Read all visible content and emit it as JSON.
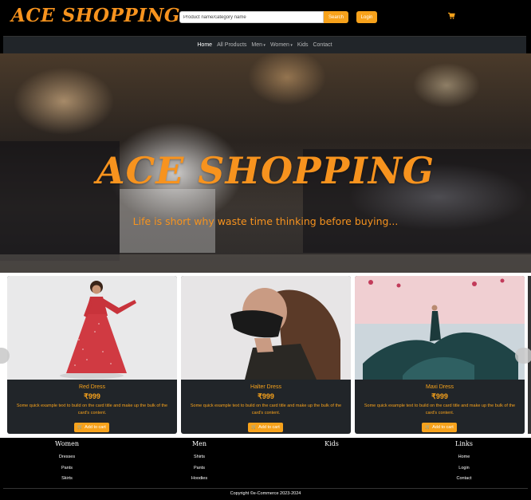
{
  "header": {
    "logo": "ACE SHOPPING",
    "search": {
      "placeholder": "Product name/category name",
      "value": ""
    },
    "search_label": "Search",
    "login_label": "Login",
    "cart_icon": "cart-icon"
  },
  "nav": {
    "items": [
      {
        "label": "Home"
      },
      {
        "label": "All Products"
      },
      {
        "label": "Men"
      },
      {
        "label": "Women"
      },
      {
        "label": "Kids"
      },
      {
        "label": "Contact"
      }
    ]
  },
  "hero": {
    "title": "ACE SHOPPING",
    "subtitle": "Life is short why waste time thinking before buying..."
  },
  "products": [
    {
      "name": "Red Dress",
      "price": "₹999",
      "text": "Some quick example text to build on the card title and make up the bulk of the card's content.",
      "cta": "Add to cart"
    },
    {
      "name": "Halter Dress",
      "price": "₹999",
      "text": "Some quick example text to build on the card title and make up the bulk of the card's content.",
      "cta": "Add to cart"
    },
    {
      "name": "Maxi Dress",
      "price": "₹999",
      "text": "Some quick example text to build on the card title and make up the bulk of the card's content.",
      "cta": "Add to cart"
    }
  ],
  "footer": {
    "columns": [
      {
        "heading": "Women",
        "links": [
          "Dresses",
          "Pants",
          "Skirts"
        ]
      },
      {
        "heading": "Men",
        "links": [
          "Shirts",
          "Pants",
          "Hoodies"
        ]
      },
      {
        "heading": "Kids",
        "links": []
      },
      {
        "heading": "Links",
        "links": [
          "Home",
          "Login",
          "Contact"
        ]
      }
    ],
    "copyright": "Copyright ©e-Commerce 2023-2024"
  },
  "colors": {
    "accent": "#f7a21b",
    "logo": "#f7931e",
    "nav_bg": "#212529",
    "card_bg": "#212529"
  }
}
